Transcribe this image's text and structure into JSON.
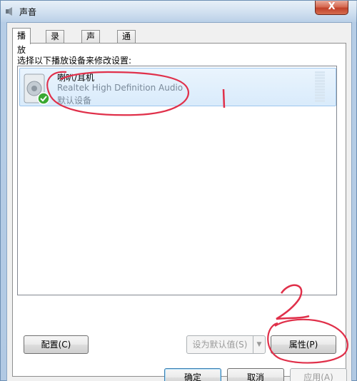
{
  "window": {
    "title": "声音",
    "close_label": "X"
  },
  "tabs": [
    {
      "label": "播放",
      "active": true
    },
    {
      "label": "录制",
      "active": false
    },
    {
      "label": "声音",
      "active": false
    },
    {
      "label": "通信",
      "active": false
    }
  ],
  "playback": {
    "instruction": "选择以下播放设备来修改设置:",
    "devices": [
      {
        "name": "喇叭/耳机",
        "description": "Realtek High Definition Audio",
        "status": "默认设备",
        "icon": "speaker-icon",
        "default": true
      }
    ]
  },
  "buttons": {
    "configure": "配置(C)",
    "set_default": "设为默认值(S)",
    "properties": "属性(P)",
    "ok": "确定",
    "cancel": "取消",
    "apply": "应用(A)"
  },
  "annotations": {
    "mark_1": "1",
    "mark_2": "2",
    "color": "#e0304a"
  },
  "colors": {
    "selection": "#d9ebfb",
    "frame": "#b6cde6"
  }
}
